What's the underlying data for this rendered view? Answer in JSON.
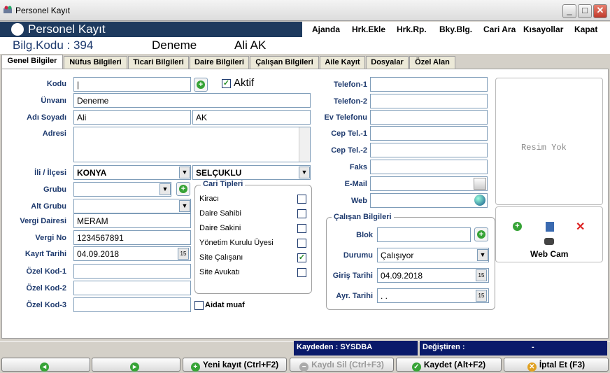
{
  "window": {
    "title": "Personel Kayıt",
    "minimize": "_",
    "maximize": "□",
    "close": "✕"
  },
  "header": {
    "title": "Personel Kayıt",
    "menu": [
      "Ajanda",
      "Hrk.Ekle",
      "Hrk.Rp.",
      "Bky.Blg.",
      "Cari Ara",
      "Kısayollar",
      "Kapat"
    ]
  },
  "info": {
    "code": "Bilg.Kodu : 394",
    "title": "Deneme",
    "name": "Ali AK"
  },
  "tabs": [
    "Genel Bilgiler",
    "Nüfus Bilgileri",
    "Ticari Bilgileri",
    "Daire Bilgileri",
    "Çalışan Bilgileri",
    "Aile Kayıt",
    "Dosyalar",
    "Özel Alan"
  ],
  "form": {
    "kodu_label": "Kodu",
    "kodu_value": "|",
    "aktif_label": "Aktif",
    "aktif_check": "✓",
    "unvani_label": "Ünvanı",
    "unvani_value": "Deneme",
    "adsoyad_label": "Adı Soyadı",
    "ad_value": "Ali",
    "soyad_value": "AK",
    "adres_label": "Adresi",
    "il_label": "İli / İlçesi",
    "il_value": "KONYA",
    "ilce_value": "SELÇUKLU",
    "grubu_label": "Grubu",
    "altgrup_label": "Alt Grubu",
    "vergidaire_label": "Vergi Dairesi",
    "vergidaire_value": "MERAM",
    "vergino_label": "Vergi No",
    "vergino_value": "1234567891",
    "kayittarih_label": "Kayıt Tarihi",
    "kayittarih_value": "04.09.2018",
    "ozelkod1_label": "Özel Kod-1",
    "ozelkod2_label": "Özel Kod-2",
    "ozelkod3_label": "Özel Kod-3",
    "aidat_label": "Aidat muaf"
  },
  "cari": {
    "title": "Cari Tipleri",
    "items": [
      "Kiracı",
      "Daire Sahibi",
      "Daire Sakini",
      "Yönetim Kurulu Üyesi",
      "Site Çalışanı",
      "Site Avukatı"
    ],
    "checked_mark": "✓"
  },
  "contact": {
    "labels": [
      "Telefon-1",
      "Telefon-2",
      "Ev Telefonu",
      "Cep Tel.-1",
      "Cep Tel.-2",
      "Faks",
      "E-Mail",
      "Web"
    ]
  },
  "calisan": {
    "title": "Çalışan Bilgileri",
    "blok_label": "Blok",
    "durum_label": "Durumu",
    "durum_value": "Çalışıyor",
    "giris_label": "Giriş Tarihi",
    "giris_value": "04.09.2018",
    "ayr_label": "Ayr. Tarihi",
    "ayr_value": ". ."
  },
  "photo": {
    "empty_text": "Resim Yok",
    "webcam_label": "Web Cam"
  },
  "status": {
    "kaydeden": "Kaydeden : SYSDBA",
    "degistiren": "Değiştiren :",
    "degistiren_value": "-"
  },
  "buttons": {
    "yeni": "Yeni kayıt (Ctrl+F2)",
    "sil": "Kaydı Sil (Ctrl+F3)",
    "kaydet": "Kaydet (Alt+F2)",
    "iptal": "İptal Et (F3)"
  },
  "colors": {
    "header_bg": "#1e3a5e",
    "label_color": "#1e3a6e",
    "status_bg": "#0a1a6a"
  }
}
